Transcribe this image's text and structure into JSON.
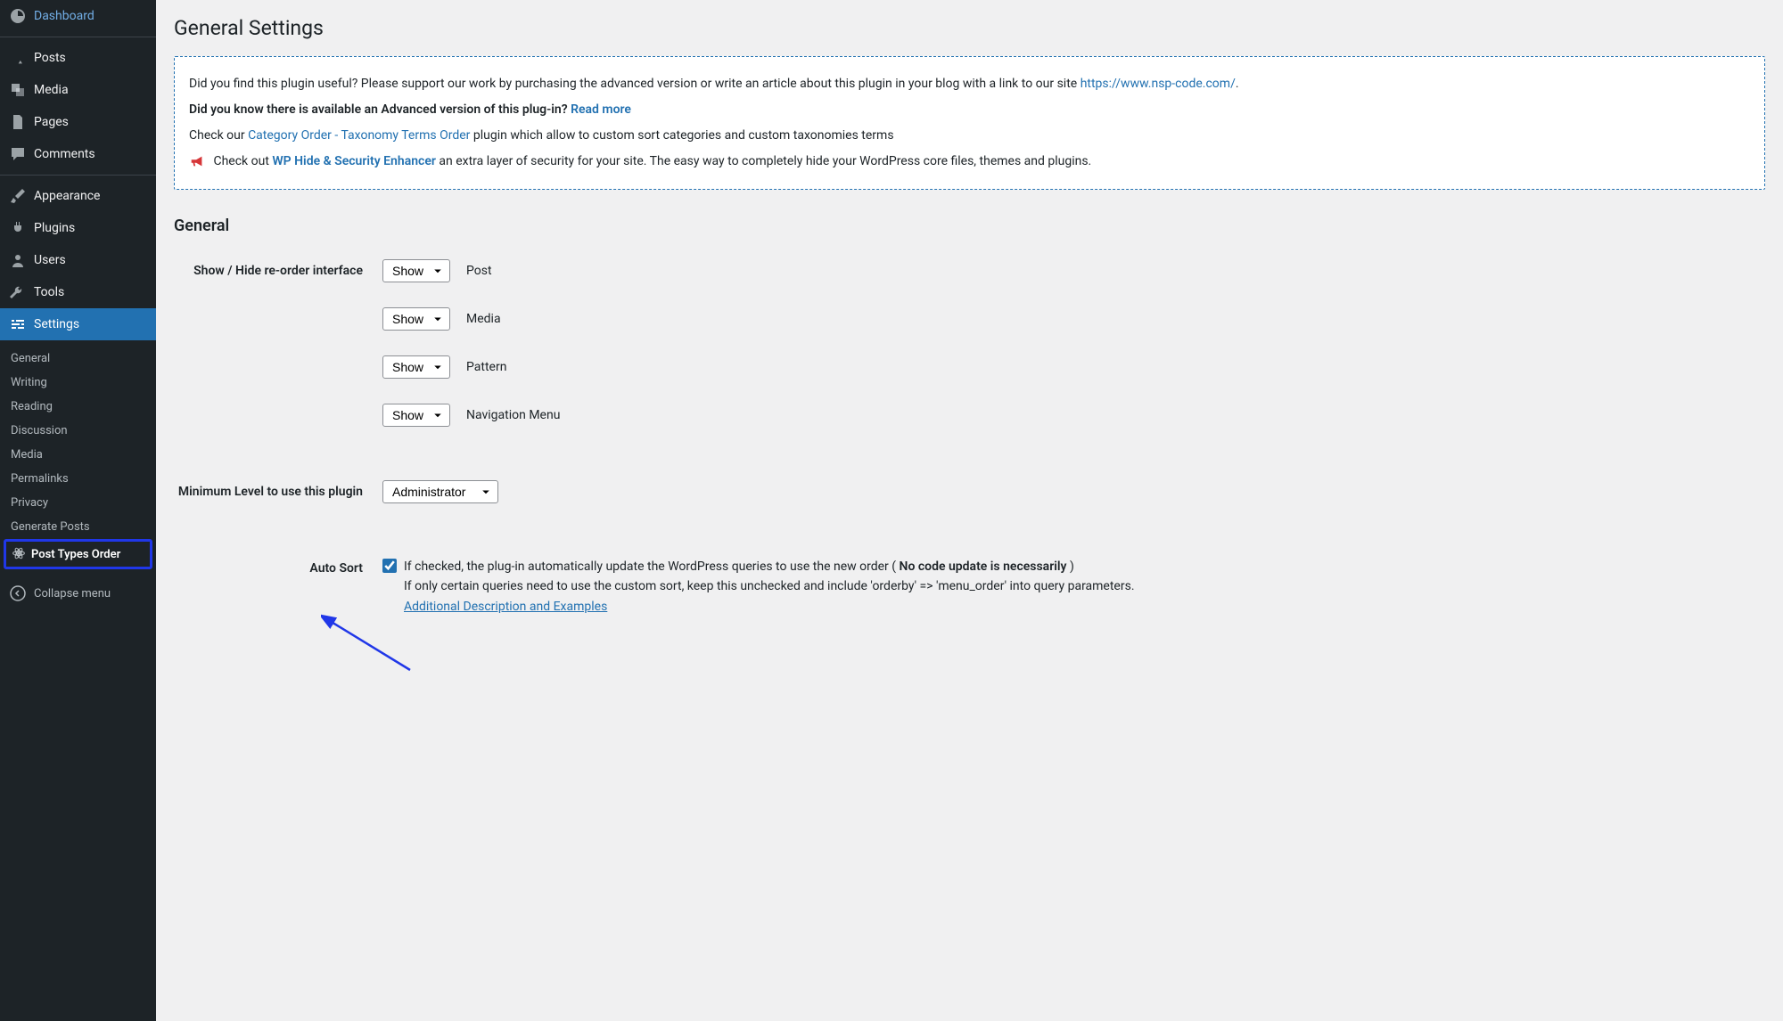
{
  "sidebar": {
    "items": [
      {
        "label": "Dashboard"
      },
      {
        "label": "Posts"
      },
      {
        "label": "Media"
      },
      {
        "label": "Pages"
      },
      {
        "label": "Comments"
      },
      {
        "label": "Appearance"
      },
      {
        "label": "Plugins"
      },
      {
        "label": "Users"
      },
      {
        "label": "Tools"
      },
      {
        "label": "Settings"
      }
    ],
    "submenu": [
      {
        "label": "General"
      },
      {
        "label": "Writing"
      },
      {
        "label": "Reading"
      },
      {
        "label": "Discussion"
      },
      {
        "label": "Media"
      },
      {
        "label": "Permalinks"
      },
      {
        "label": "Privacy"
      },
      {
        "label": "Generate Posts"
      },
      {
        "label": "Post Types Order"
      }
    ],
    "collapse": "Collapse menu"
  },
  "page": {
    "title": "General Settings"
  },
  "notice": {
    "line1_before": "Did you find this plugin useful? Please support our work by purchasing the advanced version or write an article about this plugin in your blog with a link to our site ",
    "line1_link": "https://www.nsp-code.com/",
    "line1_after": ".",
    "line2_before": "Did you know there is available an Advanced version of this plug-in? ",
    "line2_link": "Read more",
    "line3_before": "Check our ",
    "line3_link": "Category Order - Taxonomy Terms Order",
    "line3_after": " plugin which allow to custom sort categories and custom taxonomies terms",
    "line4_before": "Check out ",
    "line4_link": "WP Hide & Security Enhancer",
    "line4_after": " an extra layer of security for your site. The easy way to completely hide your WordPress core files, themes and plugins."
  },
  "section": {
    "title": "General"
  },
  "form": {
    "showhide_label": "Show / Hide re-order interface",
    "select_show": "Show",
    "rows": [
      {
        "label": "Post"
      },
      {
        "label": "Media"
      },
      {
        "label": "Pattern"
      },
      {
        "label": "Navigation Menu"
      }
    ],
    "minlevel_label": "Minimum Level to use this plugin",
    "minlevel_value": "Administrator",
    "autosort_label": "Auto Sort",
    "autosort_desc1_before": "If checked, the plug-in automatically update the WordPress queries to use the new order ( ",
    "autosort_desc1_bold": "No code update is necessarily",
    "autosort_desc1_after": " )",
    "autosort_desc2": "If only certain queries need to use the custom sort, keep this unchecked and include 'orderby' => 'menu_order' into query parameters.",
    "autosort_link": "Additional Description and Examples"
  }
}
